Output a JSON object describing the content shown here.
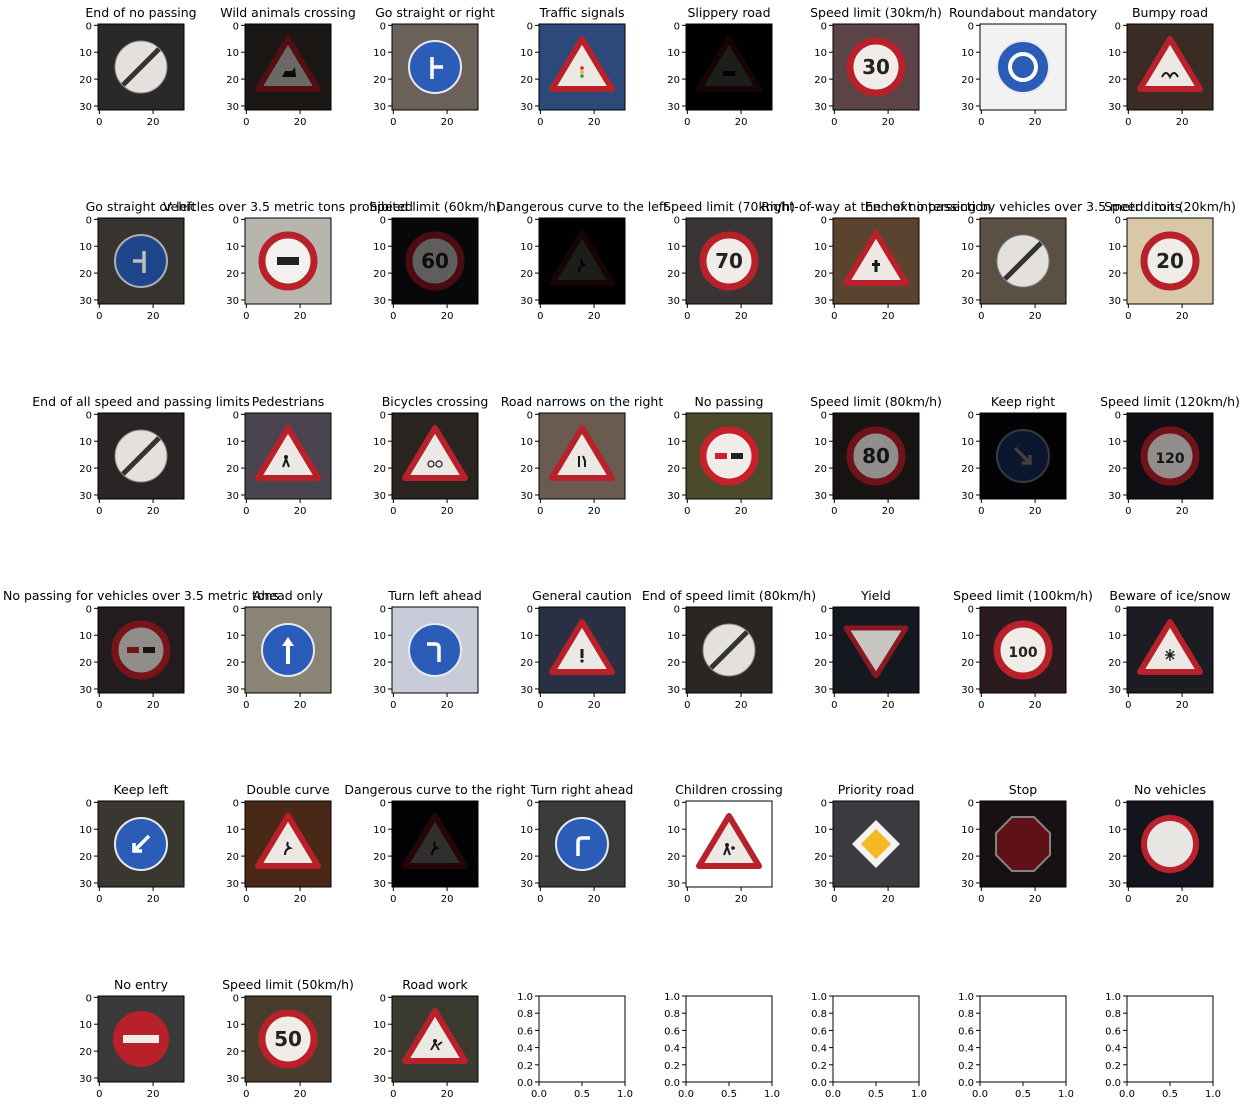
{
  "chart_data": {
    "type": "image-grid",
    "rows": 6,
    "cols": 8,
    "image_axes": {
      "xticks": [
        0,
        20
      ],
      "yticks": [
        0,
        10,
        20,
        30
      ],
      "xlim": [
        0,
        32
      ],
      "ylim": [
        32,
        0
      ]
    },
    "empty_axes": {
      "xticks": [
        "0.0",
        "0.5",
        "1.0"
      ],
      "yticks": [
        "0.0",
        "0.2",
        "0.4",
        "0.6",
        "0.8",
        "1.0"
      ],
      "xlim": [
        0,
        1
      ],
      "ylim": [
        0,
        1
      ]
    },
    "panels": [
      {
        "title": "End of no passing",
        "sign": "circle-end",
        "bg": "#2a2828"
      },
      {
        "title": "Wild animals crossing",
        "sign": "triangle",
        "bg": "#3a3430",
        "glyph": "deer",
        "dim": 0.45
      },
      {
        "title": "Go straight or right",
        "sign": "blue-circle",
        "bg": "#6a6258",
        "glyph": "straight-right"
      },
      {
        "title": "Traffic signals",
        "sign": "triangle",
        "bg": "#2b4a7a",
        "glyph": "lights"
      },
      {
        "title": "Slippery road",
        "sign": "triangle",
        "bg": "#0c0a0d",
        "glyph": "car",
        "dim": 0.12
      },
      {
        "title": "Speed limit (30km/h)",
        "sign": "speed",
        "bg": "#5a4448",
        "speed": "30"
      },
      {
        "title": "Roundabout mandatory",
        "sign": "blue-circle",
        "bg": "#f2f2f2",
        "glyph": "roundabout"
      },
      {
        "title": "Bumpy road",
        "sign": "triangle",
        "bg": "#3a2c24",
        "glyph": "bump"
      },
      {
        "title": "Go straight or left",
        "sign": "blue-circle",
        "bg": "#4a4640",
        "glyph": "straight-left",
        "dim": 0.75
      },
      {
        "title": "Vehicles over 3.5 metric tons prohibited",
        "sign": "no-truck",
        "bg": "#b8b4ae"
      },
      {
        "title": "Speed limit (60km/h)",
        "sign": "speed",
        "bg": "#14121a",
        "speed": "60",
        "dim": 0.4
      },
      {
        "title": "Dangerous curve to the left",
        "sign": "triangle",
        "bg": "#0b0a0f",
        "glyph": "curve",
        "dim": 0.12
      },
      {
        "title": "Speed limit (70km/h)",
        "sign": "speed",
        "bg": "#3a3434",
        "speed": "70"
      },
      {
        "title": "Right-of-way at the next intersection",
        "sign": "triangle",
        "bg": "#5a4430",
        "glyph": "cross"
      },
      {
        "title": "End of no passing by vehicles over 3.5 metric tons",
        "sign": "circle-end",
        "bg": "#5a5044"
      },
      {
        "title": "Speed limit (20km/h)",
        "sign": "speed",
        "bg": "#d8c8a8",
        "speed": "20"
      },
      {
        "title": "End of all speed and passing limits",
        "sign": "circle-end",
        "bg": "#2a2424"
      },
      {
        "title": "Pedestrians",
        "sign": "triangle",
        "bg": "#4a4450",
        "glyph": "person"
      },
      {
        "title": "Bicycles crossing",
        "sign": "triangle",
        "bg": "#2a2420",
        "glyph": "bike"
      },
      {
        "title": "Road narrows on the right",
        "sign": "triangle",
        "bg": "#6a5a50",
        "glyph": "narrow"
      },
      {
        "title": "No passing",
        "sign": "no-passing",
        "bg": "#4a4a2a"
      },
      {
        "title": "Speed limit (80km/h)",
        "sign": "speed",
        "bg": "#2a2222",
        "speed": "80",
        "dim": 0.6
      },
      {
        "title": "Keep right",
        "sign": "blue-circle",
        "bg": "#0c0c14",
        "glyph": "keep-right",
        "dim": 0.25
      },
      {
        "title": "Speed limit (120km/h)",
        "sign": "speed",
        "bg": "#1a1a22",
        "speed": "120",
        "dim": 0.6
      },
      {
        "title": "No passing for vehicles over 3.5 metric tons",
        "sign": "no-passing",
        "bg": "#3a3034",
        "dim": 0.6
      },
      {
        "title": "Ahead only",
        "sign": "blue-circle",
        "bg": "#8a8474",
        "glyph": "ahead"
      },
      {
        "title": "Turn left ahead",
        "sign": "blue-circle",
        "bg": "#c8ccd8",
        "glyph": "turn-left"
      },
      {
        "title": "General caution",
        "sign": "triangle",
        "bg": "#2a3044",
        "glyph": "exclaim"
      },
      {
        "title": "End of speed limit (80km/h)",
        "sign": "circle-end",
        "bg": "#2a2624"
      },
      {
        "title": "Yield",
        "sign": "yield",
        "bg": "#161820"
      },
      {
        "title": "Speed limit (100km/h)",
        "sign": "speed",
        "bg": "#2a1c1e",
        "speed": "100"
      },
      {
        "title": "Beware of ice/snow",
        "sign": "triangle",
        "bg": "#1c1c22",
        "glyph": "snow"
      },
      {
        "title": "Keep left",
        "sign": "blue-circle",
        "bg": "#3a3630",
        "glyph": "keep-left"
      },
      {
        "title": "Double curve",
        "sign": "triangle",
        "bg": "#4a2818",
        "glyph": "curve"
      },
      {
        "title": "Dangerous curve to the right",
        "sign": "triangle",
        "bg": "#0c0e18",
        "glyph": "curve",
        "dim": 0.2
      },
      {
        "title": "Turn right ahead",
        "sign": "blue-circle",
        "bg": "#3a3c3c",
        "glyph": "turn-right"
      },
      {
        "title": "Children crossing",
        "sign": "triangle",
        "bg": "#ffffff",
        "glyph": "children"
      },
      {
        "title": "Priority road",
        "sign": "priority",
        "bg": "#3a3a40"
      },
      {
        "title": "Stop",
        "sign": "stop",
        "bg": "#2a2024",
        "dim": 0.55
      },
      {
        "title": "No vehicles",
        "sign": "no-vehicles",
        "bg": "#14141c"
      },
      {
        "title": "No entry",
        "sign": "no-entry",
        "bg": "#3a3a3a"
      },
      {
        "title": "Speed limit (50km/h)",
        "sign": "speed",
        "bg": "#4a3c2c",
        "speed": "50"
      },
      {
        "title": "Road work",
        "sign": "triangle",
        "bg": "#3a3a30",
        "glyph": "work"
      },
      {
        "empty": true
      },
      {
        "empty": true
      },
      {
        "empty": true
      },
      {
        "empty": true
      },
      {
        "empty": true
      }
    ]
  }
}
